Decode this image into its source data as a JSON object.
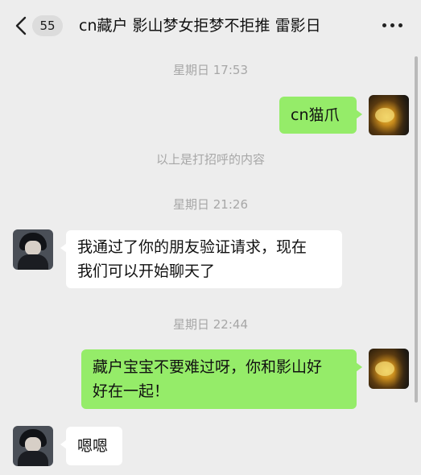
{
  "header": {
    "unread_count": "55",
    "title": "cn藏户 影山梦女拒梦不拒推 雷影日"
  },
  "messages": [
    {
      "kind": "timestamp",
      "text": "星期日 17:53"
    },
    {
      "kind": "outgoing",
      "text": "cn猫爪"
    },
    {
      "kind": "system",
      "text": "以上是打招呼的内容"
    },
    {
      "kind": "timestamp",
      "text": "星期日 21:26"
    },
    {
      "kind": "incoming",
      "lines": [
        "我通过了你的朋友验证请求，现在",
        "我们可以开始聊天了"
      ]
    },
    {
      "kind": "timestamp",
      "text": "星期日 22:44"
    },
    {
      "kind": "outgoing",
      "lines": [
        "藏户宝宝不要难过呀，你和影山好",
        "好在一起！"
      ]
    },
    {
      "kind": "incoming",
      "text": "嗯嗯"
    }
  ],
  "icons": {
    "back": "chevron-left-icon",
    "more": "more-dots-icon"
  },
  "colors": {
    "background": "#ededed",
    "outgoing_bubble": "#95ec69",
    "incoming_bubble": "#ffffff",
    "timestamp_text": "#a7a7a7"
  }
}
